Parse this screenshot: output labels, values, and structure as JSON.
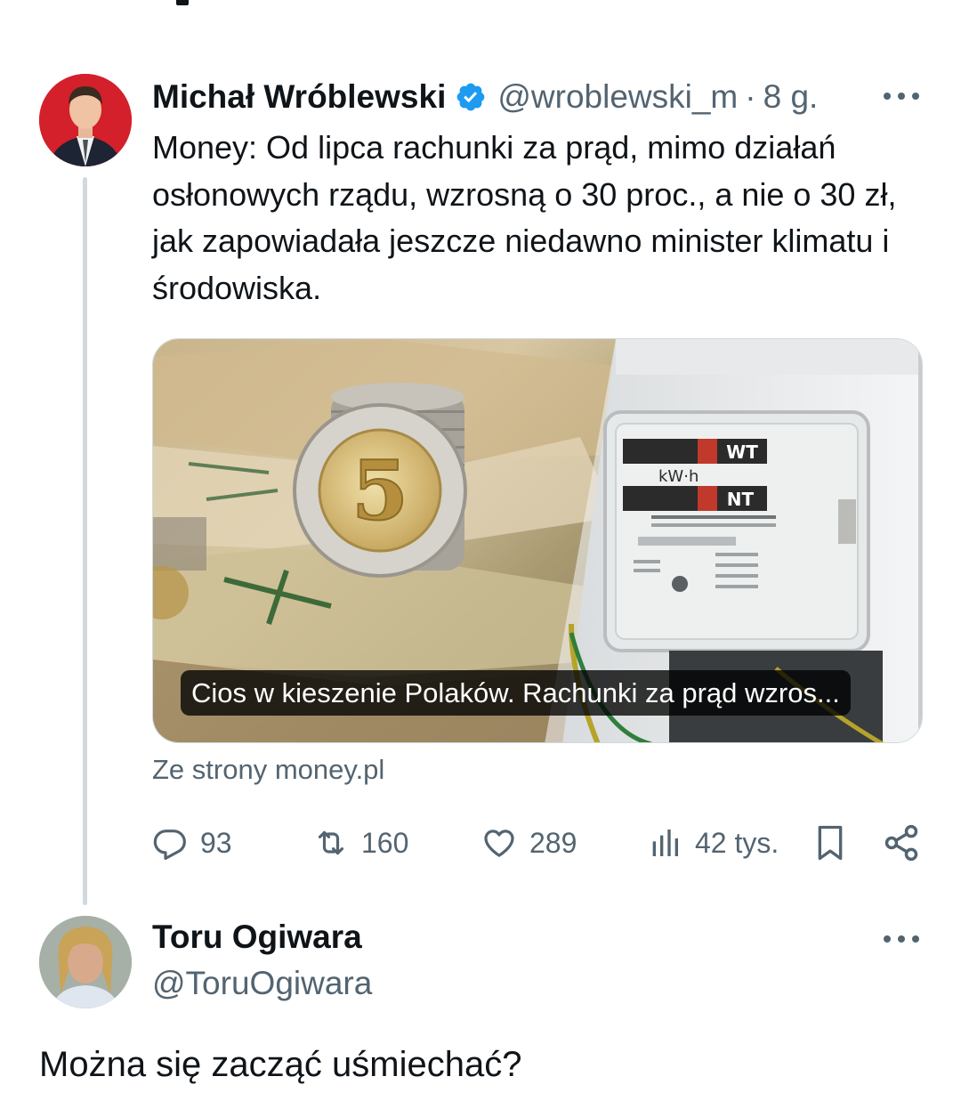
{
  "tweet": {
    "author_name": "Michał Wróblewski",
    "handle": "@wroblewski_m",
    "separator": "·",
    "time": "8 g.",
    "text": "Money: Od lipca rachunki za prąd, mimo działań osłonowych rządu, wzrosną o 30 proc., a nie o 30 zł, jak zapowiadała jeszcze niedawno minister klimatu i środowiska.",
    "card": {
      "title": "Cios w kieszenie Polaków. Rachunki za prąd wzros...",
      "source": "Ze strony money.pl",
      "image_text": {
        "coin_value": "5",
        "meter_wt": "WT",
        "meter_unit": "kW·h",
        "meter_nt": "NT"
      }
    },
    "actions": {
      "replies": "93",
      "retweets": "160",
      "likes": "289",
      "views": "42 tys."
    }
  },
  "reply": {
    "author_name": "Toru Ogiwara",
    "handle": "@ToruOgiwara",
    "text": "Można się zacząć uśmiechać?"
  },
  "colors": {
    "text_primary": "#0f1419",
    "text_secondary": "#536471",
    "verified_blue": "#1d9bf0",
    "thread_line": "#cfd9de"
  },
  "icons": [
    "verified-badge-icon",
    "more-icon",
    "reply-icon",
    "retweet-icon",
    "like-icon",
    "views-icon",
    "bookmark-icon",
    "share-icon"
  ]
}
